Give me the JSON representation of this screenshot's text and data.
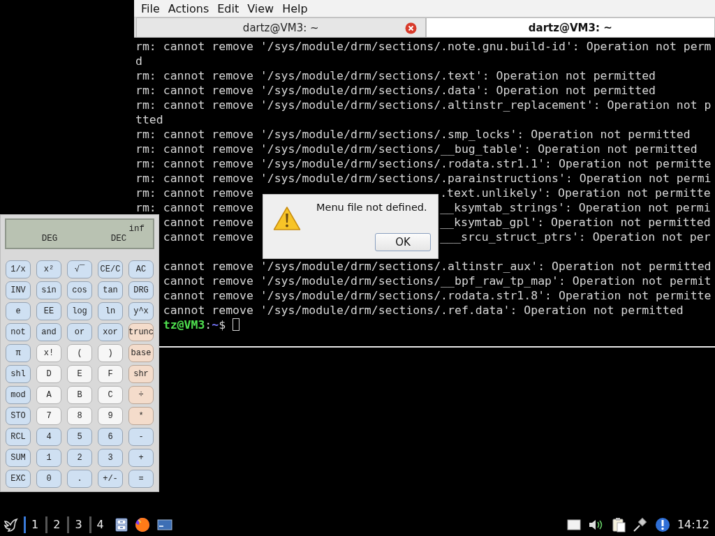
{
  "terminal": {
    "menu": [
      "File",
      "Actions",
      "Edit",
      "View",
      "Help"
    ],
    "tabs": [
      {
        "title": "dartz@VM3: ~",
        "selected": false
      },
      {
        "title": "dartz@VM3: ~",
        "selected": true
      }
    ],
    "lines": [
      {
        "kind": "full",
        "text": "rm: cannot remove '/sys/module/drm/sections/.note.gnu.build-id': Operation not perm"
      },
      {
        "kind": "full",
        "text": "d"
      },
      {
        "kind": "full",
        "text": "rm: cannot remove '/sys/module/drm/sections/.text': Operation not permitted"
      },
      {
        "kind": "full",
        "text": "rm: cannot remove '/sys/module/drm/sections/.data': Operation not permitted"
      },
      {
        "kind": "full",
        "text": "rm: cannot remove '/sys/module/drm/sections/.altinstr_replacement': Operation not p"
      },
      {
        "kind": "full",
        "text": "tted"
      },
      {
        "kind": "full",
        "text": "rm: cannot remove '/sys/module/drm/sections/.smp_locks': Operation not permitted"
      },
      {
        "kind": "full",
        "text": "rm: cannot remove '/sys/module/drm/sections/__bug_table': Operation not permitted"
      },
      {
        "kind": "full",
        "text": "rm: cannot remove '/sys/module/drm/sections/.rodata.str1.1': Operation not permitte"
      },
      {
        "kind": "full",
        "text": "rm: cannot remove '/sys/module/drm/sections/.parainstructions': Operation not permi"
      },
      {
        "kind": "split",
        "left": "rm: cannot remove",
        "right": ".text.unlikely': Operation not permitte"
      },
      {
        "kind": "split",
        "left": "rm: cannot remove",
        "right": "__ksymtab_strings': Operation not permi"
      },
      {
        "kind": "clipped-split",
        "left": "cannot remove",
        "right": "__ksymtab_gpl': Operation not permitted"
      },
      {
        "kind": "clipped-split",
        "left": "cannot remove",
        "right": "___srcu_struct_ptrs': Operation not per"
      },
      {
        "kind": "blank"
      },
      {
        "kind": "clipped",
        "text": "cannot remove '/sys/module/drm/sections/.altinstr_aux': Operation not permitted"
      },
      {
        "kind": "clipped",
        "text": "cannot remove '/sys/module/drm/sections/__bpf_raw_tp_map': Operation not permit"
      },
      {
        "kind": "clipped",
        "text": "cannot remove '/sys/module/drm/sections/.rodata.str1.8': Operation not permitte"
      },
      {
        "kind": "clipped",
        "text": "cannot remove '/sys/module/drm/sections/.ref.data': Operation not permitted"
      },
      {
        "kind": "prompt",
        "user_host": "tz@VM3",
        "separator": ":",
        "path": "~",
        "symbol": "$"
      }
    ]
  },
  "calculator": {
    "display": {
      "value": "inf",
      "angle_mode": "DEG",
      "base_mode": "DEC"
    },
    "keys": [
      {
        "label": "1/x",
        "kind": "function"
      },
      {
        "label": "x²",
        "kind": "function"
      },
      {
        "label": "√‾",
        "kind": "function"
      },
      {
        "label": "CE/C",
        "kind": "function"
      },
      {
        "label": "AC",
        "kind": "function"
      },
      {
        "label": "INV",
        "kind": "function"
      },
      {
        "label": "sin",
        "kind": "function"
      },
      {
        "label": "cos",
        "kind": "function"
      },
      {
        "label": "tan",
        "kind": "function"
      },
      {
        "label": "DRG",
        "kind": "function"
      },
      {
        "label": "e",
        "kind": "function"
      },
      {
        "label": "EE",
        "kind": "function"
      },
      {
        "label": "log",
        "kind": "function"
      },
      {
        "label": "ln",
        "kind": "function"
      },
      {
        "label": "y^x",
        "kind": "function"
      },
      {
        "label": "not",
        "kind": "function"
      },
      {
        "label": "and",
        "kind": "function"
      },
      {
        "label": "or",
        "kind": "function"
      },
      {
        "label": "xor",
        "kind": "function"
      },
      {
        "label": "trunc",
        "kind": "operator"
      },
      {
        "label": "π",
        "kind": "function"
      },
      {
        "label": "x!",
        "kind": "digit"
      },
      {
        "label": "(",
        "kind": "digit"
      },
      {
        "label": ")",
        "kind": "digit"
      },
      {
        "label": "base",
        "kind": "operator"
      },
      {
        "label": "shl",
        "kind": "function"
      },
      {
        "label": "D",
        "kind": "digit"
      },
      {
        "label": "E",
        "kind": "digit"
      },
      {
        "label": "F",
        "kind": "digit"
      },
      {
        "label": "shr",
        "kind": "operator"
      },
      {
        "label": "mod",
        "kind": "function"
      },
      {
        "label": "A",
        "kind": "digit"
      },
      {
        "label": "B",
        "kind": "digit"
      },
      {
        "label": "C",
        "kind": "digit"
      },
      {
        "label": "÷",
        "kind": "operator"
      },
      {
        "label": "STO",
        "kind": "function"
      },
      {
        "label": "7",
        "kind": "digit"
      },
      {
        "label": "8",
        "kind": "digit"
      },
      {
        "label": "9",
        "kind": "digit"
      },
      {
        "label": "*",
        "kind": "operator"
      },
      {
        "label": "RCL",
        "kind": "function"
      },
      {
        "label": "4",
        "kind": "function"
      },
      {
        "label": "5",
        "kind": "function"
      },
      {
        "label": "6",
        "kind": "function"
      },
      {
        "label": "-",
        "kind": "function"
      },
      {
        "label": "SUM",
        "kind": "function"
      },
      {
        "label": "1",
        "kind": "function"
      },
      {
        "label": "2",
        "kind": "function"
      },
      {
        "label": "3",
        "kind": "function"
      },
      {
        "label": "+",
        "kind": "function"
      },
      {
        "label": "EXC",
        "kind": "function"
      },
      {
        "label": "0",
        "kind": "function"
      },
      {
        "label": ".",
        "kind": "function"
      },
      {
        "label": "+/-",
        "kind": "function"
      },
      {
        "label": "=",
        "kind": "function"
      }
    ]
  },
  "dialog": {
    "message": "Menu file not defined.",
    "button": "OK"
  },
  "taskbar": {
    "workspaces": [
      {
        "label": "1",
        "selected": true
      },
      {
        "label": "2",
        "selected": false
      },
      {
        "label": "3",
        "selected": false
      },
      {
        "label": "4",
        "selected": false
      }
    ],
    "clock": "14:12"
  }
}
